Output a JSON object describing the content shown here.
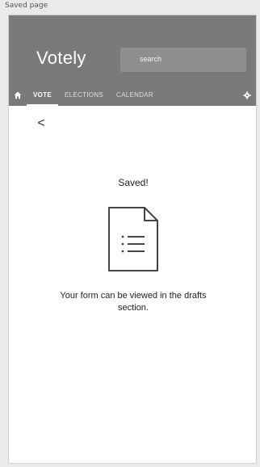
{
  "window": {
    "title": "Saved page"
  },
  "app": {
    "name": "Votely",
    "search": {
      "placeholder": "search"
    }
  },
  "tabs": [
    {
      "label": "VOTE",
      "active": true
    },
    {
      "label": "ELECTIONS",
      "active": false
    },
    {
      "label": "CALENDAR",
      "active": false
    }
  ],
  "icons": {
    "home": "home-icon",
    "settings": "gear-icon",
    "back": "back-arrow-icon",
    "document": "document-list-icon"
  },
  "content": {
    "back_glyph": "<",
    "title": "Saved!",
    "message": "Your form can be viewed in the drafts section."
  },
  "colors": {
    "appbar": "#7a7a7a",
    "search_bg": "#8f8f8f",
    "text": "#222222"
  }
}
